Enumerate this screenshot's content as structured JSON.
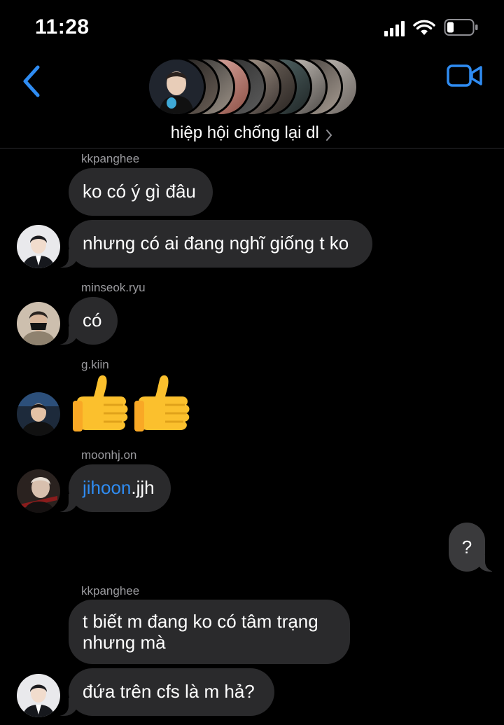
{
  "status": {
    "time": "11:28"
  },
  "header": {
    "title": "hiệp hội chống lại dl"
  },
  "messages": {
    "sender1": "kkpanghee",
    "m1": "ko có ý gì đâu",
    "m2": "nhưng có ai đang nghĩ giống t ko",
    "sender2": "minseok.ryu",
    "m3": "có",
    "sender3": "g.kiin",
    "sender4": "moonhj.on",
    "m5_mention": "jihoon",
    "m5_rest": ".jjh",
    "sent1": "?",
    "sender5": "kkpanghee",
    "m6_line1": "t biết m đang ko có tâm trạng",
    "m6_line2": "nhưng mà",
    "m7": "đứa trên cfs là m hả?"
  },
  "icons": {
    "back": "chevron-left-icon",
    "video": "video-camera-icon",
    "thumbs": "thumbs-up-emoji"
  },
  "colors": {
    "accent": "#2f8cf2",
    "bubble_in": "#2a2a2c",
    "bubble_out": "#3a3a3c",
    "sender": "#9a9a9e"
  }
}
